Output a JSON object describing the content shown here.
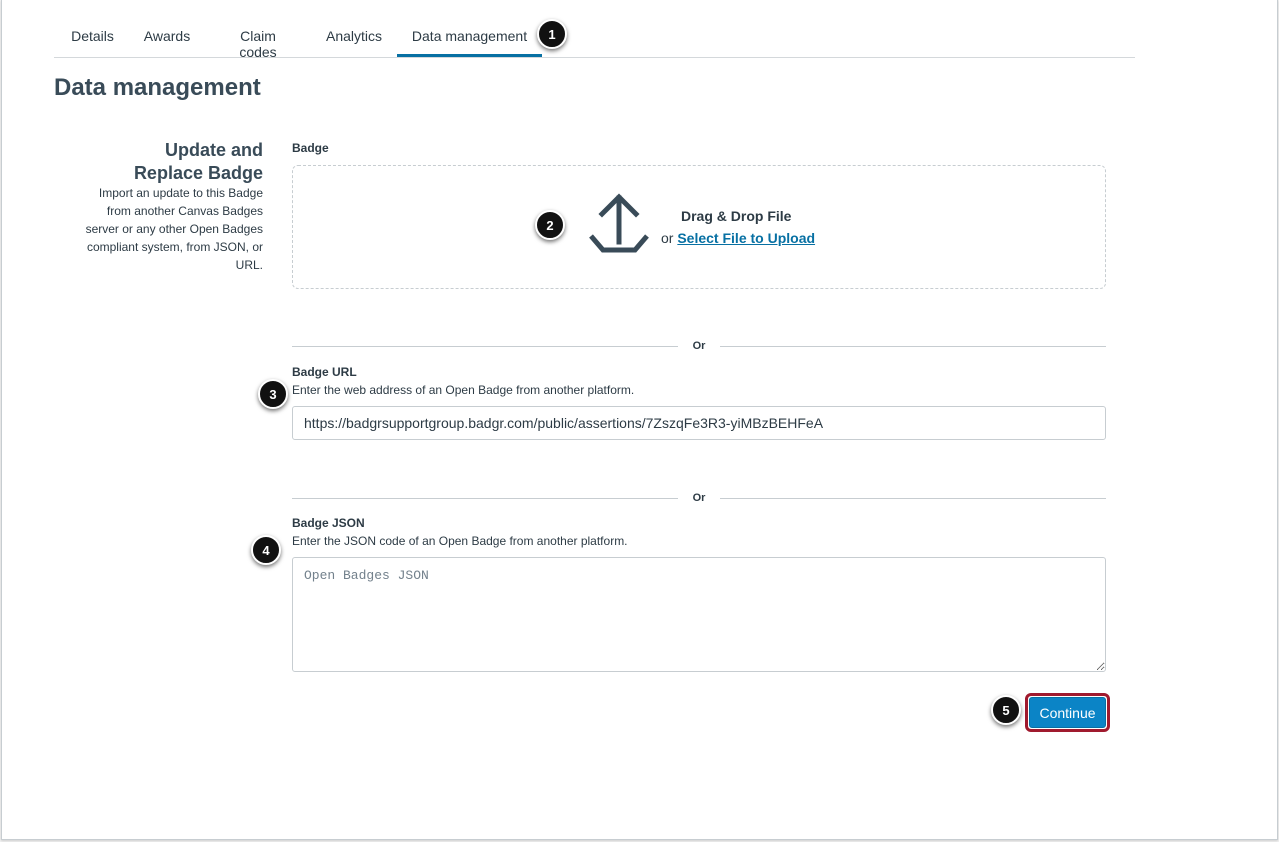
{
  "tabs": [
    {
      "label": "Details"
    },
    {
      "label": "Awards"
    },
    {
      "label": "Claim codes"
    },
    {
      "label": "Analytics"
    },
    {
      "label": "Data management",
      "active": true
    }
  ],
  "page_title": "Data management",
  "section": {
    "heading": "Update and Replace Badge",
    "description": "Import an update to this Badge from another Canvas Badges server or any other Open Badges compliant system, from JSON, or URL."
  },
  "badge_upload": {
    "label": "Badge",
    "drop_title": "Drag & Drop File",
    "or_prefix": "or",
    "select_link": "Select File to Upload",
    "icon": "upload-icon"
  },
  "dividers": {
    "or_text": "Or"
  },
  "badge_url": {
    "label": "Badge URL",
    "hint": "Enter the web address of an Open Badge from another platform.",
    "value": "https://badgrsupportgroup.badgr.com/public/assertions/7ZszqFe3R3-yiMBzBEHFeA"
  },
  "badge_json": {
    "label": "Badge JSON",
    "hint": "Enter the JSON code of an Open Badge from another platform.",
    "placeholder": "Open Badges JSON"
  },
  "continue_label": "Continue",
  "callouts": [
    "1",
    "2",
    "3",
    "4",
    "5"
  ],
  "colors": {
    "accent": "#0770a3",
    "button": "#0b84c6",
    "highlight_border": "#a01a2e",
    "text": "#2d3b45"
  }
}
